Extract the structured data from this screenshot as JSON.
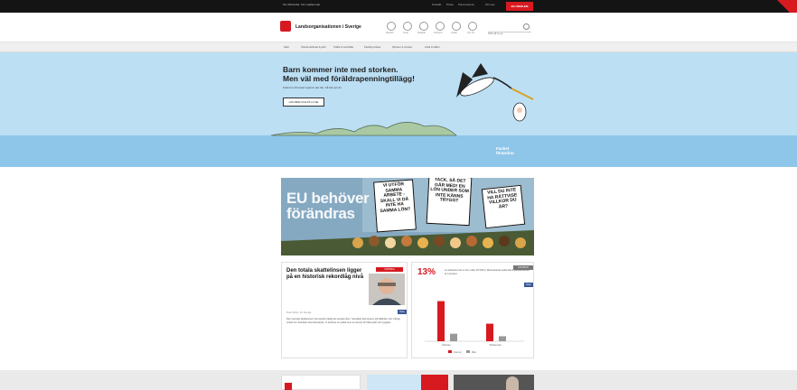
{
  "topbar": {
    "left_links": [
      "Om förbundet",
      "För medlemmar"
    ],
    "right_links": [
      "Kontakt",
      "Press",
      "Prenumerera",
      "Om oss"
    ],
    "cta_label": "BLI MEDLEM"
  },
  "header": {
    "brand": "Landsorganisationen i Sverige",
    "icons": [
      {
        "name": "person-icon",
        "label": "Medlem"
      },
      {
        "name": "document-icon",
        "label": "Avtal"
      },
      {
        "name": "chart-icon",
        "label": "Statistik"
      },
      {
        "name": "building-icon",
        "label": "Förbund"
      },
      {
        "name": "pin-icon",
        "label": "Lokalt"
      },
      {
        "name": "info-icon",
        "label": "Om LO"
      }
    ],
    "search_placeholder": "Sök på lo.se"
  },
  "nav": {
    "items": [
      "Start",
      "Arbetsmarknad & jobb",
      "Politik & samhälle",
      "Fackligt arbete",
      "Nyheter & opinion",
      "Avtal & villkor"
    ]
  },
  "hero": {
    "headline_line1": "Barn kommer inte med storken.",
    "headline_line2": "Men väl med föräldrapenningtillägg!",
    "subtext": "Kolla hur ditt avtal reglerar det här. Så här gör du",
    "button_label": "LÄS MER OCH PÅ LO.SE",
    "brand_line1": "Facket",
    "brand_line2": "förändrar"
  },
  "eu_banner": {
    "title_line1": "EU behöver",
    "title_line2": "förändras",
    "signs": [
      "VI UTFÖR SAMMA ARBETE - SKALL VI DÅ INTE HA SAMMA LÖN?",
      "TACK, SÅ DET GÅR MED! EN LÖN UNDER SOM INTE KÄNNS TRYGGT",
      "VILL DU INTE HA RÄTTVISE VILLKOR DU ÄR?"
    ]
  },
  "article_card": {
    "title": "Den totala skattelinsen ligger på en historisk rekordlåg nivå",
    "tag": "KRÖNIKA",
    "byline": "Peter Ström, LO Sverige",
    "share": "Dela",
    "body": "Den svenska skattekvoten har sjunkit kraftigt de senaste åren. Samtidigt ökar kraven på välfärden och många undrar hur framtiden ska finansieras. Vi behöver en politik som tar ansvar för både jobb och trygghet."
  },
  "stat_card": {
    "big_number": "13%",
    "description": "av arbetarna har en lön under 20 000 kr. Motsvarande andel bland tjänstemännen är 4 procent.",
    "badge": "STATISTIK",
    "share": "Dela",
    "legend": [
      "Kvinnor",
      "Män"
    ]
  },
  "chart_data": {
    "type": "bar",
    "categories": [
      "Arbetare",
      "Tjänstemän"
    ],
    "series": [
      {
        "name": "Kvinnor",
        "values": [
          16,
          7
        ]
      },
      {
        "name": "Män",
        "values": [
          3,
          2
        ]
      }
    ],
    "ylim": [
      0,
      18
    ],
    "colors": [
      "#d71920",
      "#999999"
    ]
  },
  "colors": {
    "accent": "#d71920",
    "hero_sky": "#bcdff4",
    "hero_water": "#8ec6ea",
    "topbar": "#141414"
  }
}
